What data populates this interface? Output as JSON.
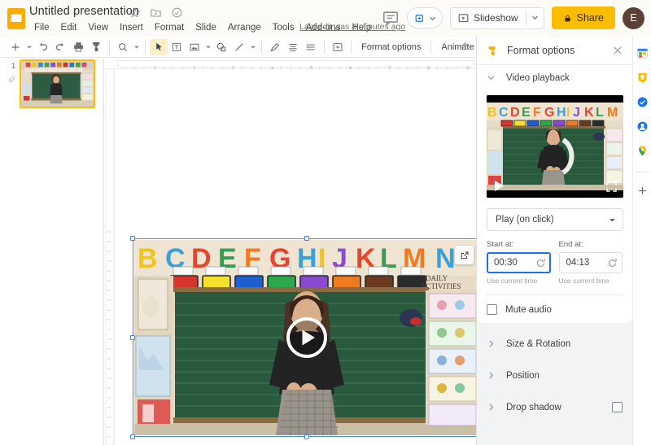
{
  "app": {
    "title": "Untitled presentation",
    "last_edit": "Last edit was 4 minutes ago"
  },
  "title_icons": [
    {
      "name": "star-icon",
      "label": "Star"
    },
    {
      "name": "move-to-folder-icon",
      "label": "Move"
    },
    {
      "name": "cloud-saved-icon",
      "label": "Saved to Drive"
    }
  ],
  "menu": {
    "items": [
      {
        "label": "File"
      },
      {
        "label": "Edit"
      },
      {
        "label": "View"
      },
      {
        "label": "Insert"
      },
      {
        "label": "Format"
      },
      {
        "label": "Slide"
      },
      {
        "label": "Arrange"
      },
      {
        "label": "Tools"
      },
      {
        "label": "Add-ons"
      },
      {
        "label": "Help"
      }
    ]
  },
  "top_right": {
    "comment_icon": "comment-icon",
    "meet_icon": "meet-camera-icon",
    "slideshow_label": "Slideshow",
    "share_label": "Share",
    "avatar_initial": "E"
  },
  "toolbar": {
    "items": [
      {
        "name": "new-slide-button",
        "icon": "plus-icon"
      },
      {
        "name": "new-slide-dropdown",
        "icon": "caret-down-icon"
      },
      {
        "name": "undo-button",
        "icon": "undo-icon"
      },
      {
        "name": "redo-button",
        "icon": "redo-icon"
      },
      {
        "name": "print-button",
        "icon": "printer-icon"
      },
      {
        "name": "paint-format-button",
        "icon": "paint-format-icon"
      },
      {
        "name": "zoom-button",
        "icon": "magnifier-icon"
      },
      {
        "name": "zoom-dropdown",
        "icon": "caret-down-icon"
      },
      {
        "name": "select-tool-button",
        "icon": "cursor-arrow-icon"
      },
      {
        "name": "text-box-button",
        "icon": "text-box-icon"
      },
      {
        "name": "insert-image-button",
        "icon": "image-icon"
      },
      {
        "name": "insert-image-dropdown",
        "icon": "caret-down-icon"
      },
      {
        "name": "shape-button",
        "icon": "shape-icon"
      },
      {
        "name": "line-button",
        "icon": "line-icon"
      },
      {
        "name": "line-dropdown",
        "icon": "caret-down-icon"
      },
      {
        "name": "pen-button",
        "icon": "pen-icon"
      },
      {
        "name": "align-button",
        "icon": "align-icon"
      },
      {
        "name": "line-spacing-button",
        "icon": "line-spacing-icon"
      },
      {
        "name": "insert-comment-button",
        "icon": "add-comment-icon"
      }
    ],
    "format_options_label": "Format options",
    "animate_label": "Animate",
    "collapse_icon": "chevron-up-icon"
  },
  "slides": {
    "current_number": "1",
    "link_icon": "link-icon"
  },
  "ruler": {
    "horizontal_marks": [
      "1",
      "2",
      "3",
      "4",
      "5",
      "6",
      "7",
      "8",
      "9"
    ]
  },
  "canvas": {
    "video": {
      "play_icon": "play-circle-icon",
      "open_link_icon": "external-link-icon",
      "selected": true
    }
  },
  "panel": {
    "title": "Format options",
    "title_icon": "paint-roller-icon",
    "close_icon": "close-icon",
    "video_playback": {
      "section_label": "Video playback",
      "expanded": true,
      "preview_play_icon": "play-triangle-icon",
      "preview_fullscreen_icon": "fullscreen-icon",
      "play_mode": "Play (on click)",
      "play_mode_caret": "caret-down-icon",
      "start_label": "Start at:",
      "start_value": "00:30",
      "start_use_current": "Use current time",
      "end_label": "End at:",
      "end_value": "04:13",
      "end_use_current": "Use current time",
      "reset_icon": "reset-icon",
      "mute_audio_label": "Mute audio",
      "mute_audio_checked": false
    },
    "sections": [
      {
        "label": "Size & Rotation",
        "expanded": false,
        "has_checkbox": false
      },
      {
        "label": "Position",
        "expanded": false,
        "has_checkbox": false
      },
      {
        "label": "Drop shadow",
        "expanded": false,
        "has_checkbox": true,
        "checked": false
      }
    ]
  },
  "side_rail": {
    "items": [
      {
        "name": "google-calendar-icon"
      },
      {
        "name": "google-keep-icon"
      },
      {
        "name": "google-tasks-icon"
      },
      {
        "name": "google-contacts-icon"
      },
      {
        "name": "google-maps-icon"
      },
      {
        "name": "add-apps-icon"
      }
    ]
  },
  "colors": {
    "accent_yellow": "#fbbc04",
    "selection_blue": "#3f87f5",
    "focus_blue": "#1a73e8",
    "panel_bg": "#f1f3f4"
  }
}
